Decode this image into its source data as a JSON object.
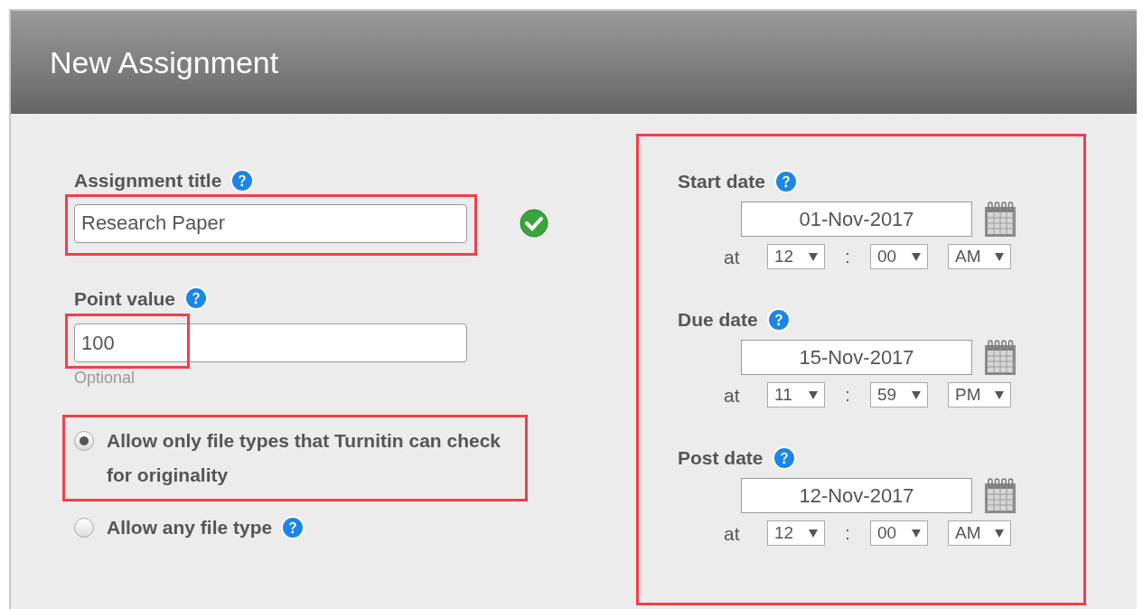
{
  "dialog": {
    "title": "New Assignment"
  },
  "title_field": {
    "label": "Assignment title",
    "value": "Research Paper",
    "valid": true,
    "highlighted": true
  },
  "point_field": {
    "label": "Point value",
    "value": "100",
    "hint": "Optional",
    "highlighted": true
  },
  "file_types": [
    {
      "label": "Allow only file types that Turnitin can check for originality",
      "selected": true,
      "help": false,
      "highlighted": true
    },
    {
      "label": "Allow any file type",
      "selected": false,
      "help": true,
      "highlighted": false
    }
  ],
  "dates": {
    "highlighted": true,
    "items": [
      {
        "label": "Start date",
        "date": "01-Nov-2017",
        "at": "at",
        "hour": "12",
        "separator": ":",
        "minute": "00",
        "period": "AM"
      },
      {
        "label": "Due date",
        "date": "15-Nov-2017",
        "at": "at",
        "hour": "11",
        "separator": ":",
        "minute": "59",
        "period": "PM"
      },
      {
        "label": "Post date",
        "date": "12-Nov-2017",
        "at": "at",
        "hour": "12",
        "separator": ":",
        "minute": "00",
        "period": "AM"
      }
    ]
  }
}
